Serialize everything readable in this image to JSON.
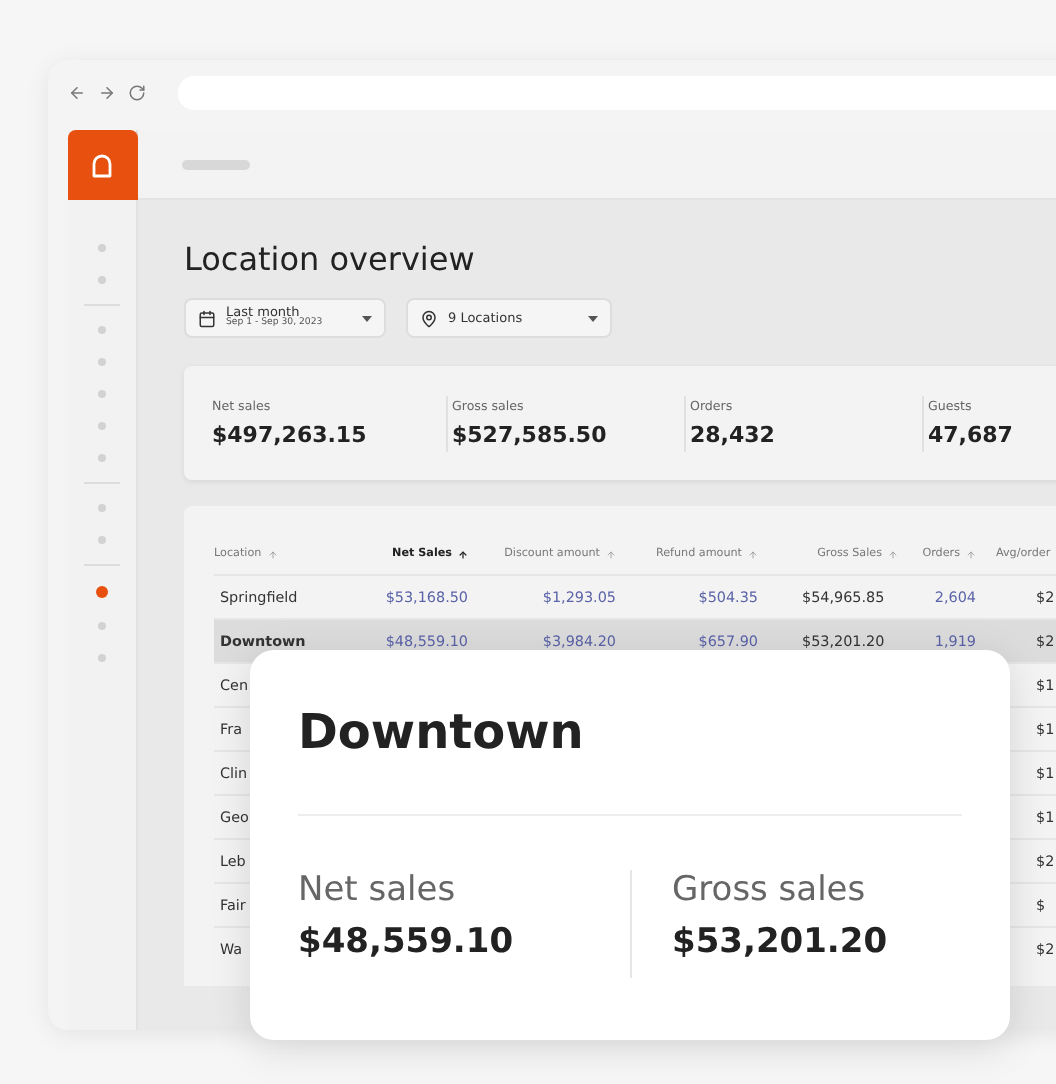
{
  "nav_items": [
    {
      "selected": false
    },
    {
      "selected": false
    },
    {
      "selected": false
    },
    {
      "selected": false
    },
    {
      "selected": false
    },
    {
      "selected": false
    },
    {
      "selected": false
    },
    {
      "selected": false
    },
    {
      "selected": false
    },
    {
      "selected": true
    },
    {
      "selected": false
    },
    {
      "selected": false
    }
  ],
  "title": "Location overview",
  "filters": [
    {
      "kind": "date",
      "label": "Last month",
      "sublabel": "Sep 1 - Sep 30, 2023"
    },
    {
      "kind": "location",
      "label": "9 Locations"
    }
  ],
  "stats": [
    {
      "label": "Net sales",
      "value": "$497,263.15"
    },
    {
      "label": "Gross sales",
      "value": "$527,585.50"
    },
    {
      "label": "Orders",
      "value": "28,432"
    },
    {
      "label": "Guests",
      "value": "47,687"
    }
  ],
  "table": {
    "columns": [
      {
        "label": "Location",
        "sorted": false
      },
      {
        "label": "Net Sales",
        "sorted": true
      },
      {
        "label": "Discount amount",
        "sorted": false
      },
      {
        "label": "Refund amount",
        "sorted": false
      },
      {
        "label": "Gross Sales",
        "sorted": false
      },
      {
        "label": "Orders",
        "sorted": false
      },
      {
        "label": "Avg/order",
        "sorted": false
      }
    ],
    "rows": [
      {
        "selected": false,
        "cells": [
          "Springfield",
          "$53,168.50",
          "$1,293.05",
          "$504.35",
          "$54,965.85",
          "2,604",
          "$2"
        ]
      },
      {
        "selected": true,
        "cells": [
          "Downtown",
          "$48,559.10",
          "$3,984.20",
          "$657.90",
          "$53,201.20",
          "1,919",
          "$2"
        ]
      },
      {
        "selected": false,
        "cells": [
          "Cen",
          "$1"
        ]
      },
      {
        "selected": false,
        "cells": [
          "Fra",
          "$1"
        ]
      },
      {
        "selected": false,
        "cells": [
          "Clin",
          "$1"
        ]
      },
      {
        "selected": false,
        "cells": [
          "Geo",
          "$1"
        ]
      },
      {
        "selected": false,
        "cells": [
          "Leb",
          "$2"
        ]
      },
      {
        "selected": false,
        "cells": [
          "Fair",
          "$"
        ]
      },
      {
        "selected": false,
        "cells": [
          "Wa",
          "$2"
        ]
      }
    ]
  },
  "popup": {
    "title": "Downtown",
    "stats": [
      {
        "label": "Net sales",
        "value": "$48,559.10"
      },
      {
        "label": "Gross sales",
        "value": "$53,201.20"
      }
    ]
  }
}
